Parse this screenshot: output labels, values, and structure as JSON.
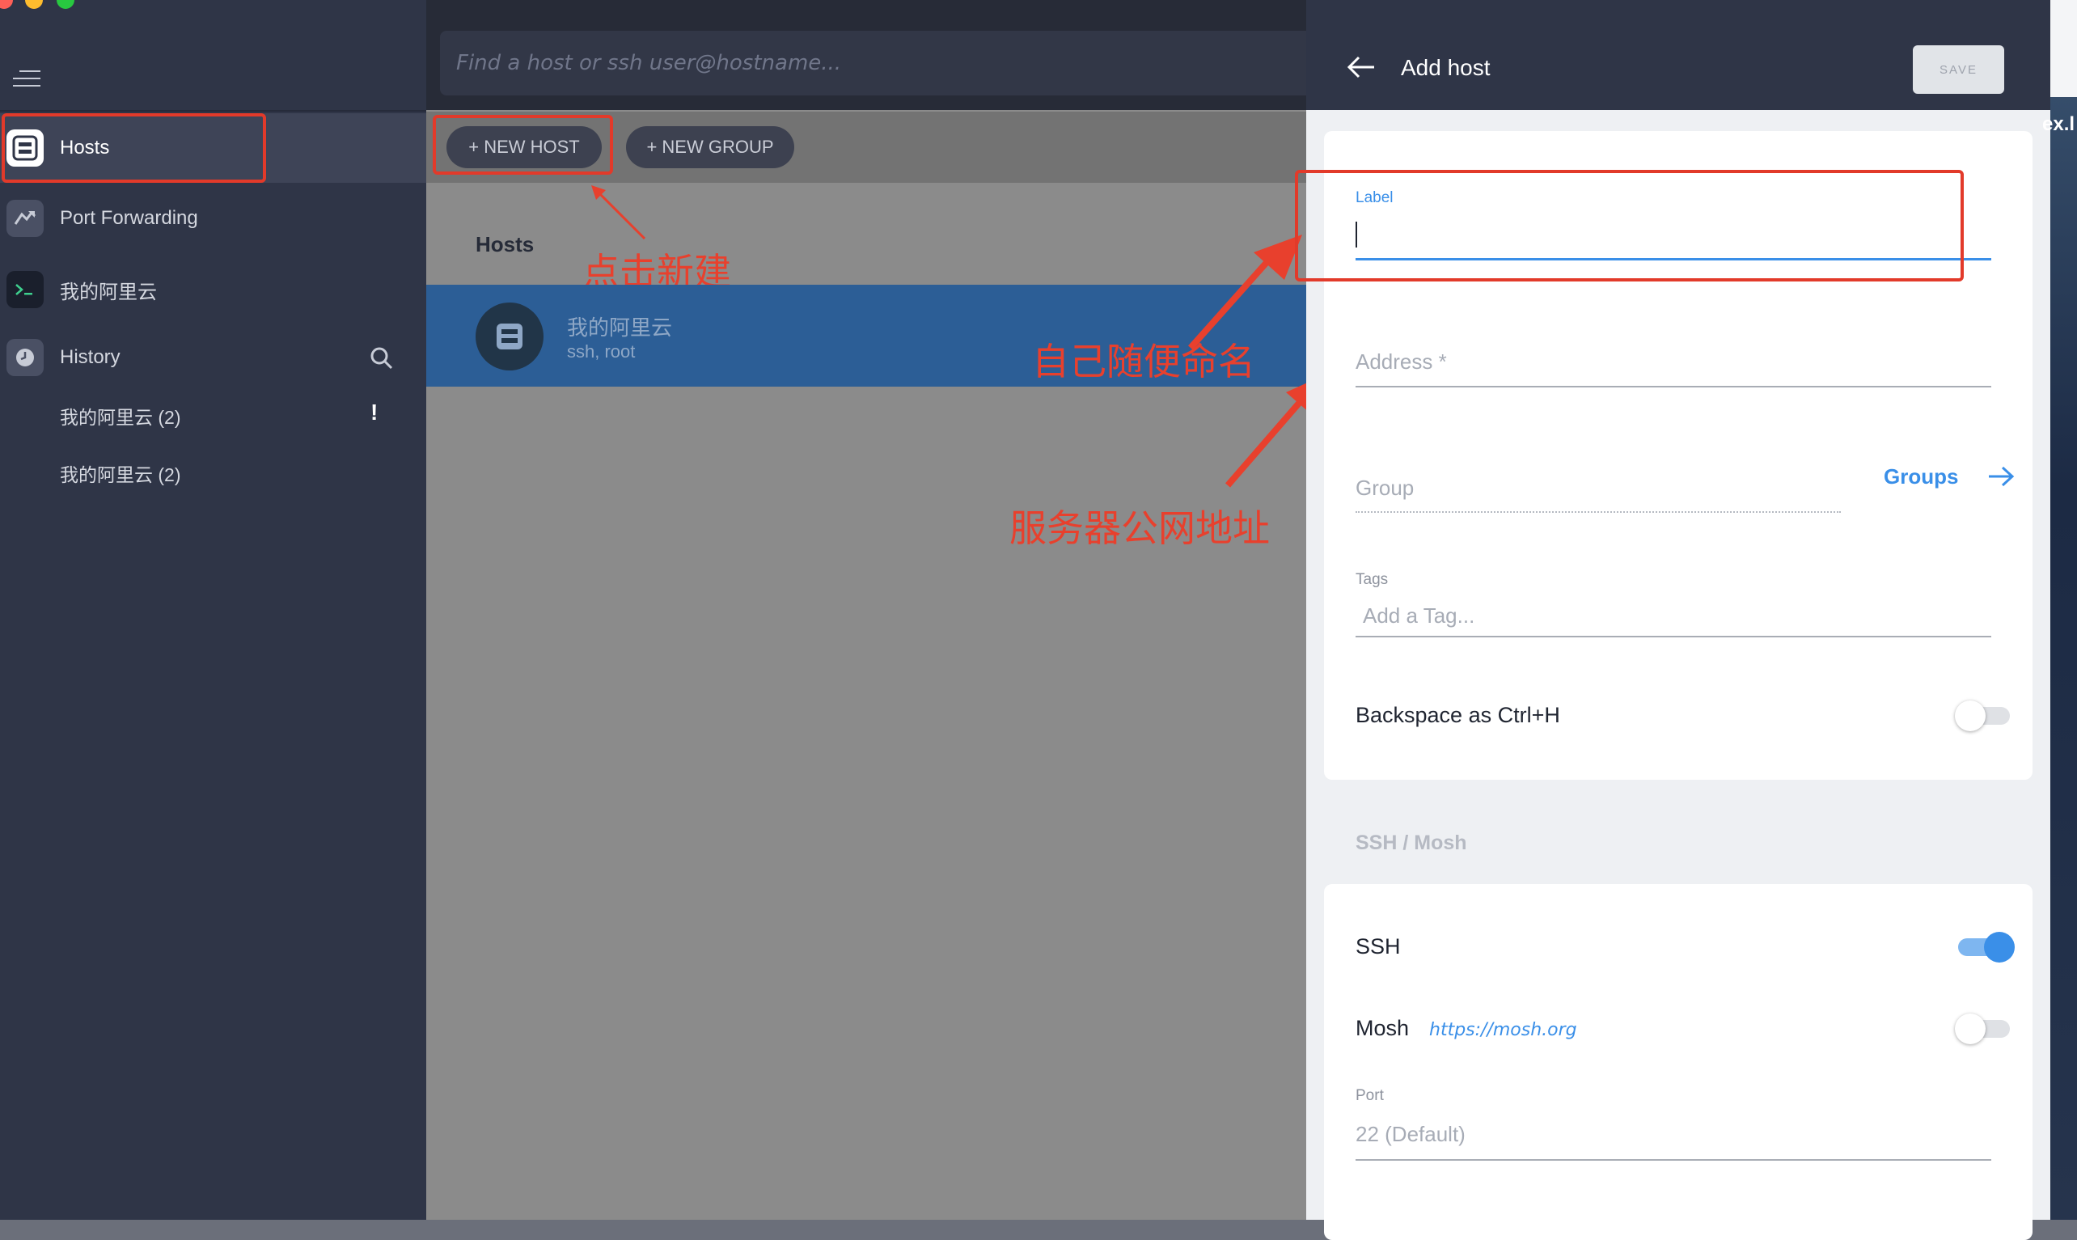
{
  "window": {
    "traffic_lights": [
      "#fe5f57",
      "#febc2e",
      "#28c840"
    ]
  },
  "sidebar": {
    "items": [
      {
        "label": "Hosts",
        "icon": "server-icon"
      },
      {
        "label": "Port Forwarding",
        "icon": "port-forwarding-icon"
      },
      {
        "label": "我的阿里云",
        "icon": "terminal-icon"
      },
      {
        "label": "History",
        "icon": "clock-icon"
      }
    ],
    "history_items": [
      {
        "label": "我的阿里云 (2)",
        "badge": "!"
      },
      {
        "label": "我的阿里云 (2)"
      }
    ]
  },
  "search": {
    "placeholder": "Find a host or ssh user@hostname..."
  },
  "toolbar": {
    "new_host": "+ NEW HOST",
    "new_group": "+ NEW GROUP"
  },
  "hosts_section": {
    "title": "Hosts",
    "hosts": [
      {
        "name": "我的阿里云",
        "subtitle": "ssh, root"
      }
    ]
  },
  "annotations": {
    "click_new": "点击新建",
    "name_freely": "自己随便命名",
    "public_address": "服务器公网地址"
  },
  "panel": {
    "title": "Add host",
    "save": "SAVE",
    "label_field": {
      "label": "Label",
      "value": ""
    },
    "address_field": {
      "placeholder": "Address *"
    },
    "group_field": {
      "placeholder": "Group",
      "link": "Groups"
    },
    "tags_field": {
      "label": "Tags",
      "placeholder": "Add a Tag..."
    },
    "backspace": {
      "label": "Backspace as Ctrl+H",
      "enabled": false
    },
    "ssh_mosh_header": "SSH / Mosh",
    "ssh": {
      "label": "SSH",
      "enabled": true
    },
    "mosh": {
      "label": "Mosh",
      "link": "https://mosh.org",
      "enabled": false
    },
    "port": {
      "label": "Port",
      "placeholder": "22 (Default)"
    }
  },
  "desktop": {
    "text": "ex.l"
  },
  "colors": {
    "accent": "#3a8fe8",
    "annotation_red": "#e23a2a",
    "sidebar_bg": "#2f3547",
    "selected_host_bg": "#2c5e96"
  }
}
